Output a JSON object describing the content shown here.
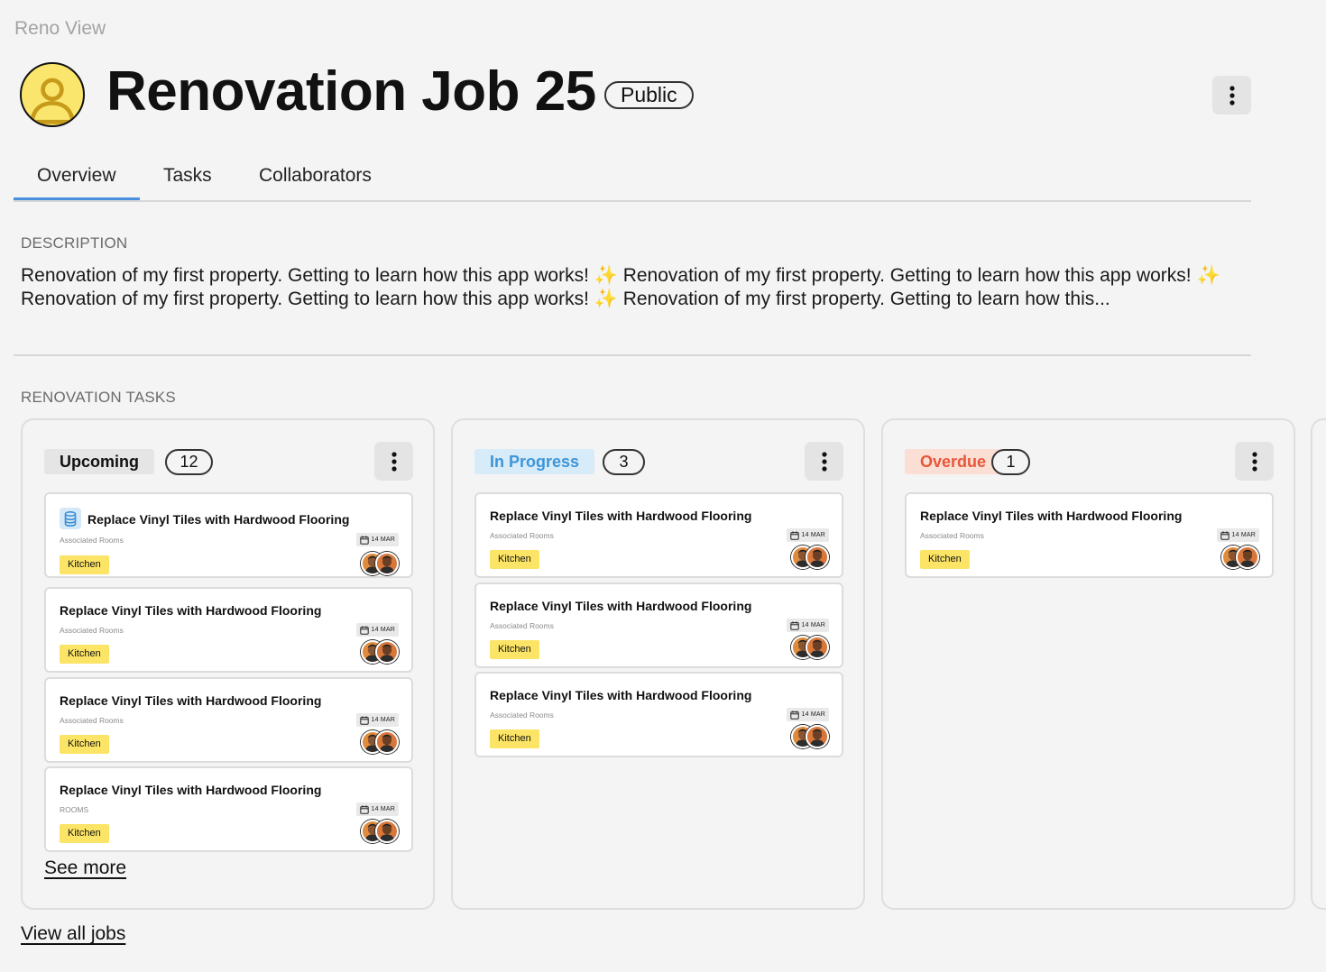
{
  "breadcrumb": "Reno View",
  "header": {
    "title": "Renovation Job 25",
    "visibility": "Public"
  },
  "tabs": [
    "Overview",
    "Tasks",
    "Collaborators"
  ],
  "active_tab": "Overview",
  "description": {
    "label": "DESCRIPTION",
    "text": "Renovation of my first property. Getting to learn how this app works! ✨ Renovation of my first property. Getting to learn how this app works! ✨ Renovation of my first property. Getting to learn how this app works! ✨ Renovation of my first property. Getting to learn how this..."
  },
  "tasks_section": {
    "label": "RENOVATION TASKS"
  },
  "columns": [
    {
      "status": "Upcoming",
      "count": "12",
      "status_bg": "#e5e5e5",
      "status_color": "#111111",
      "cards": [
        {
          "title": "Replace Vinyl Tiles with Hardwood Flooring",
          "subtitle": "Associated Rooms",
          "room": "Kitchen",
          "date": "14 MAR",
          "icon": "database-icon"
        },
        {
          "title": "Replace Vinyl Tiles with Hardwood Flooring",
          "subtitle": "Associated Rooms",
          "room": "Kitchen",
          "date": "14 MAR"
        },
        {
          "title": "Replace Vinyl Tiles with Hardwood Flooring",
          "subtitle": "Associated Rooms",
          "room": "Kitchen",
          "date": "14 MAR"
        },
        {
          "title": "Replace Vinyl Tiles with Hardwood Flooring",
          "subtitle": "ROOMS",
          "room": "Kitchen",
          "date": "14 MAR"
        }
      ],
      "see_more": "See more"
    },
    {
      "status": "In Progress",
      "count": "3",
      "status_bg": "#d7ebf9",
      "status_color": "#3d96d8",
      "cards": [
        {
          "title": "Replace Vinyl Tiles with Hardwood Flooring",
          "subtitle": "Associated Rooms",
          "room": "Kitchen",
          "date": "14 MAR"
        },
        {
          "title": "Replace Vinyl Tiles with Hardwood Flooring",
          "subtitle": "Associated Rooms",
          "room": "Kitchen",
          "date": "14 MAR"
        },
        {
          "title": "Replace Vinyl Tiles with Hardwood Flooring",
          "subtitle": "Associated Rooms",
          "room": "Kitchen",
          "date": "14 MAR"
        }
      ]
    },
    {
      "status": "Overdue",
      "count": "1",
      "status_bg": "#fbded4",
      "status_color": "#e8563a",
      "cards": [
        {
          "title": "Replace Vinyl Tiles with Hardwood Flooring",
          "subtitle": "Associated Rooms",
          "room": "Kitchen",
          "date": "14 MAR"
        }
      ]
    }
  ],
  "footer_link": "View all jobs",
  "colors": {
    "accent": "#4a8fdd",
    "room_tag": "#fbe466",
    "avatar_bg": "#fbe66d"
  }
}
